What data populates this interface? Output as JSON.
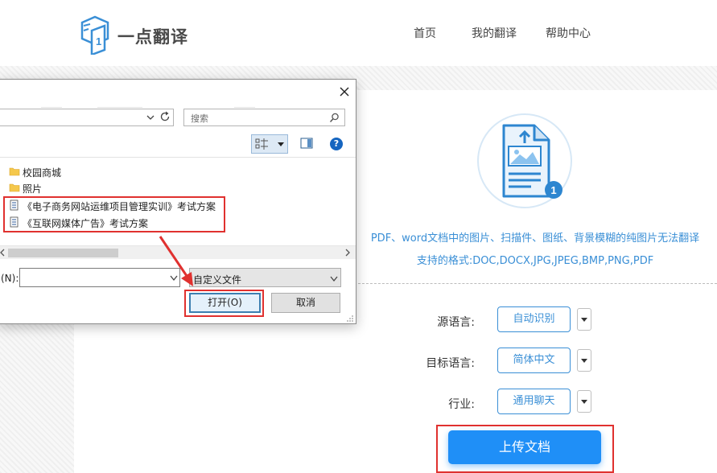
{
  "site": {
    "logo_text": "一点翻译",
    "nav": {
      "home": "首页",
      "my_translations": "我的翻译",
      "help_center": "帮助中心"
    }
  },
  "upload_panel": {
    "badge_count": "1",
    "info_line_1": "PDF、word文档中的图片、扫描件、图纸、背景模糊的纯图片无法翻译",
    "info_line_2": "支持的格式:DOC,DOCX,JPG,JPEG,BMP,PNG,PDF",
    "source_language_label": "源语言:",
    "source_language_value": "自动识别",
    "target_language_label": "目标语言:",
    "target_language_value": "简体中文",
    "industry_label": "行业:",
    "industry_value": "通用聊天",
    "upload_button": "上传文档",
    "accent_color": "#1f8ff7",
    "highlight_color": "#e0312f"
  },
  "file_dialog": {
    "search_placeholder": "搜索",
    "help_glyph": "?",
    "files": [
      {
        "name": "校园商城",
        "type": "folder"
      },
      {
        "name": "照片",
        "type": "folder"
      },
      {
        "name": "《电子商务网站运维项目管理实训》考试方案",
        "type": "document"
      },
      {
        "name": "《互联网媒体广告》考试方案",
        "type": "document"
      }
    ],
    "filename_label": "(N):",
    "filename_value": "",
    "file_type_filter": "自定义文件",
    "open_button": "打开(O)",
    "cancel_button": "取消"
  }
}
